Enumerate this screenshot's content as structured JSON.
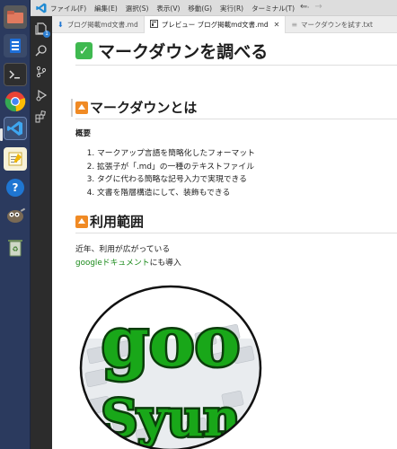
{
  "dock": {
    "items": [
      {
        "name": "folder",
        "color": "#5a5a5a"
      },
      {
        "name": "terminal",
        "color": "#3a3a3a"
      },
      {
        "name": "chrome",
        "color": "#ea4335"
      },
      {
        "name": "vscode",
        "color": "#1f8ad2"
      },
      {
        "name": "text-editor",
        "color": "#f6c142"
      },
      {
        "name": "help",
        "color": "#1f76d2"
      },
      {
        "name": "gimp",
        "color": "#6d5a45"
      },
      {
        "name": "trash",
        "color": "#6b8a5a"
      }
    ]
  },
  "menu": {
    "file": "ファイル(F)",
    "edit": "編集(E)",
    "selection": "選択(S)",
    "view": "表示(V)",
    "go": "移動(G)",
    "run": "実行(R)",
    "terminal": "ターミナル(T)",
    "more": "···",
    "back": "←",
    "forward": "→"
  },
  "tabs": [
    {
      "label": "ブログ掲載md文書.md",
      "icon": "markdown-icon",
      "active": false
    },
    {
      "label": "プレビュー ブログ掲載md文書.md",
      "icon": "preview-icon",
      "active": true,
      "close": "✕"
    },
    {
      "label": "マークダウンを試す.txt",
      "icon": "text-file-icon",
      "active": false
    }
  ],
  "doc": {
    "title": "マークダウンを調べる",
    "section1": {
      "heading": "マークダウンとは",
      "subheading": "概要",
      "items": [
        "マークアップ言語を簡略化したフォーマット",
        "拡張子が「.md」の一種のテキストファイル",
        "タグに代わる簡略な記号入力で実現できる",
        "文書を階層構造にして、装飾もできる"
      ]
    },
    "section2": {
      "heading": "利用範囲",
      "line1": "近年、利用が広がっている",
      "line2_link": "googleドキュメント",
      "line2_rest": "にも導入"
    },
    "image": {
      "top_text": "goo",
      "bottom_text": "Syun"
    }
  },
  "colors": {
    "accent_green": "#1a8a1a",
    "activity_bar": "#2c2c2c",
    "dock": "#2b3a5e"
  }
}
